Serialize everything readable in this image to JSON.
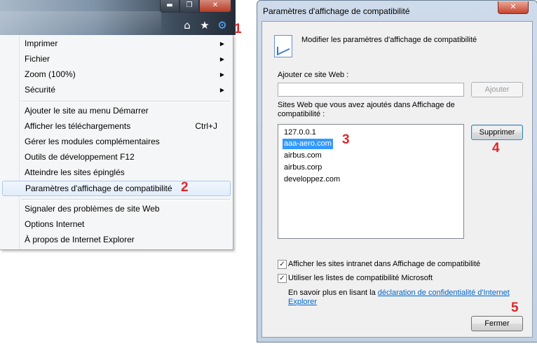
{
  "browser": {
    "window_buttons": {
      "minimize": "▬",
      "maximize": "❐",
      "close": "✕"
    },
    "toolbar_icons": [
      "home-icon",
      "star-icon",
      "gear-icon"
    ],
    "icon_glyphs": {
      "home": "⌂",
      "star": "★",
      "gear": "⚙"
    }
  },
  "menu": {
    "items": [
      {
        "label": "Imprimer",
        "arrow": "▶"
      },
      {
        "label": "Fichier",
        "arrow": "▶"
      },
      {
        "label": "Zoom (100%)",
        "arrow": "▶"
      },
      {
        "label": "Sécurité",
        "arrow": "▶"
      },
      {
        "label": "Ajouter le site au menu Démarrer"
      },
      {
        "label": "Afficher les téléchargements",
        "shortcut": "Ctrl+J"
      },
      {
        "label": "Gérer les modules complémentaires"
      },
      {
        "label": "Outils de développement F12"
      },
      {
        "label": "Atteindre les sites épinglés"
      },
      {
        "label": "Paramètres d'affichage de compatibilité"
      },
      {
        "label": "Signaler des problèmes de site Web"
      },
      {
        "label": "Options Internet"
      },
      {
        "label": "À propos de Internet Explorer"
      }
    ]
  },
  "dialog": {
    "title": "Paramètres d'affichage de compatibilité",
    "close_label": "✕",
    "header_text": "Modifier les paramètres d'affichage de compatibilité",
    "add_site_label": "Ajouter ce site Web :",
    "add_site_value": "",
    "add_button": "Ajouter",
    "list_label_line1": "Sites Web que vous avez ajoutés dans Affichage de",
    "list_label_line2": "compatibilité :",
    "sites": [
      "127.0.0.1",
      "aaa-aero.com",
      "airbus.com",
      "airbus.corp",
      "developpez.com"
    ],
    "selected_site": "aaa-aero.com",
    "remove_button": "Supprimer",
    "checkbox_intranet": "Afficher les sites intranet dans Affichage de compatibilité",
    "checkbox_intranet_checked": true,
    "checkbox_ms_lists": "Utiliser les listes de compatibilité Microsoft",
    "checkbox_ms_lists_checked": true,
    "privacy_prefix": "En savoir plus en lisant la",
    "privacy_link_line1": "déclaration de confidentialité d'Internet",
    "privacy_link_line2": "Explorer",
    "close_button": "Fermer",
    "check_glyph": "✓"
  },
  "callouts": [
    "1",
    "2",
    "3",
    "4",
    "5"
  ],
  "colors": {
    "callout": "#e0262b",
    "selection": "#3399ff",
    "link": "#0066cc"
  }
}
